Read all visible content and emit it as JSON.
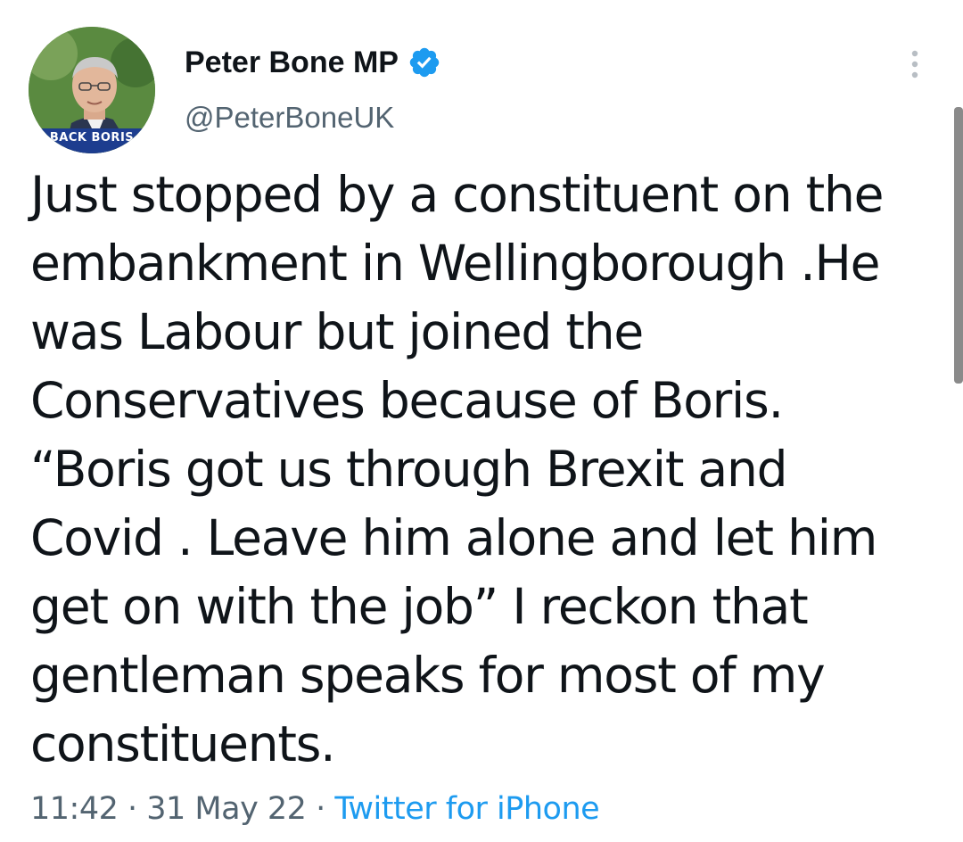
{
  "user": {
    "display_name": "Peter Bone MP",
    "handle": "@PeterBoneUK",
    "avatar_banner": "BACK BORIS",
    "verified": true
  },
  "tweet": {
    "text": "Just stopped by a constituent on the\nembankment in Wellingborough .He\nwas Labour but joined the\nConservatives because of Boris.\n“Boris got us through Brexit and\nCovid . Leave him alone and let him\nget on with the job” I reckon that\ngentleman speaks for most of my\nconstituents."
  },
  "meta": {
    "time": "11:42",
    "separator1": " · ",
    "date": "31 May 22",
    "separator2": " · ",
    "source": "Twitter for iPhone"
  },
  "colors": {
    "text": "#0f1419",
    "secondary": "#536471",
    "accent": "#1d9bf0"
  },
  "icons": {
    "verified": "verified-badge-icon",
    "more": "more-vertical-icon"
  }
}
